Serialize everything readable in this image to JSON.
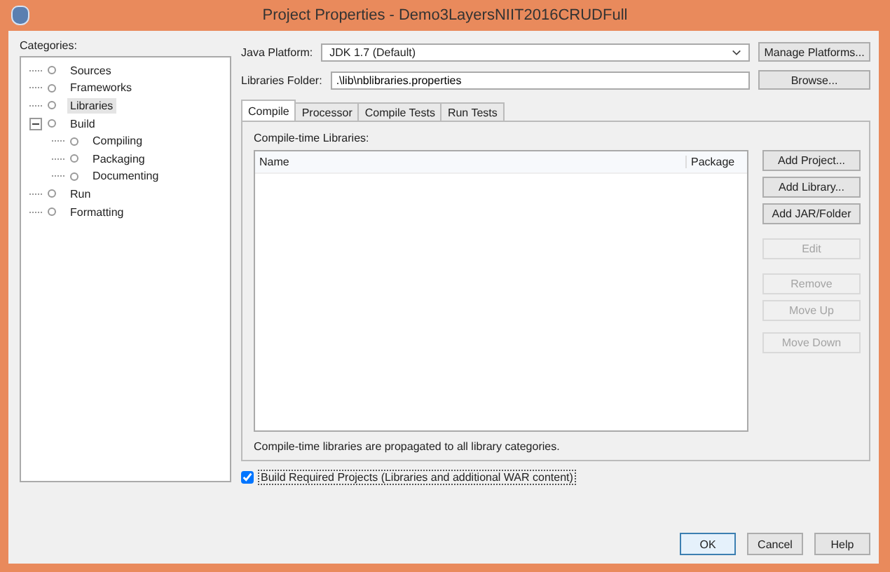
{
  "window": {
    "title": "Project Properties - Demo3LayersNIIT2016CRUDFull"
  },
  "categories": {
    "label": "Categories:",
    "items": [
      {
        "label": "Sources",
        "selected": false
      },
      {
        "label": "Frameworks",
        "selected": false
      },
      {
        "label": "Libraries",
        "selected": true
      },
      {
        "label": "Build",
        "selected": false,
        "expanded": true,
        "children": [
          {
            "label": "Compiling",
            "selected": false
          },
          {
            "label": "Packaging",
            "selected": false
          },
          {
            "label": "Documenting",
            "selected": false
          }
        ]
      },
      {
        "label": "Run",
        "selected": false
      },
      {
        "label": "Formatting",
        "selected": false
      }
    ]
  },
  "java_platform": {
    "label": "Java Platform:",
    "value": "JDK 1.7 (Default)",
    "button": "Manage Platforms..."
  },
  "libraries_folder": {
    "label": "Libraries Folder:",
    "value": ".\\lib\\nblibraries.properties",
    "button": "Browse..."
  },
  "tabs": [
    {
      "label": "Compile",
      "selected": true
    },
    {
      "label": "Processor",
      "selected": false
    },
    {
      "label": "Compile Tests",
      "selected": false
    },
    {
      "label": "Run Tests",
      "selected": false
    }
  ],
  "compile": {
    "label": "Compile-time Libraries:",
    "table": {
      "columns": [
        "Name",
        "Package"
      ]
    },
    "buttons": [
      {
        "label": "Add Project...",
        "disabled": false
      },
      {
        "label": "Add Library...",
        "disabled": false
      },
      {
        "label": "Add JAR/Folder",
        "disabled": false
      },
      {
        "label": "Edit",
        "disabled": true
      },
      {
        "label": "Remove",
        "disabled": true
      },
      {
        "label": "Move Up",
        "disabled": true
      },
      {
        "label": "Move Down",
        "disabled": true
      }
    ],
    "note": "Compile-time libraries are propagated to all library categories."
  },
  "build_required": {
    "label": "Build Required Projects (Libraries and additional WAR content)",
    "checked": true
  },
  "buttons": [
    "OK",
    "Cancel",
    "Help"
  ]
}
